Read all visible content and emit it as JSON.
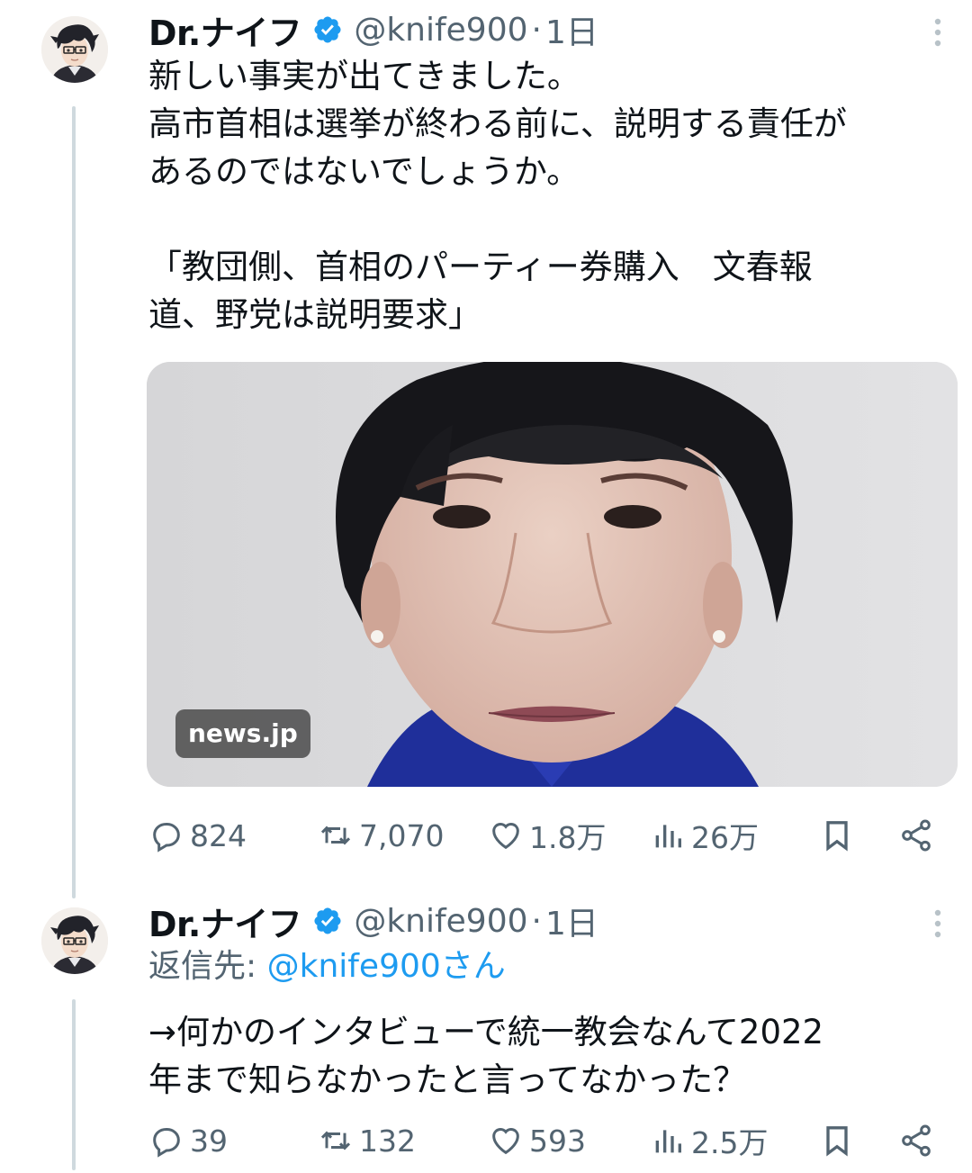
{
  "tweets": [
    {
      "author": {
        "name": "Dr.ナイフ",
        "handle": "@knife900"
      },
      "separator": "·",
      "time": "1日",
      "text": "新しい事実が出てきました。\n高市首相は選挙が終わる前に、説明する責任が\nあるのではないでしょうか。\n\n「教団側、首相のパーティー券購入　文春報\n道、野党は説明要求」",
      "media": {
        "source_badge": "news.jp"
      },
      "stats": {
        "replies": "824",
        "retweets": "7,070",
        "likes": "1.8万",
        "views": "26万"
      }
    },
    {
      "author": {
        "name": "Dr.ナイフ",
        "handle": "@knife900"
      },
      "separator": "·",
      "time": "1日",
      "reply_to": {
        "label": "返信先:",
        "mention": "@knife900さん"
      },
      "text": "→何かのインタビューで統一教会なんて2022\n年まで知らなかったと言ってなかった？",
      "stats": {
        "replies": "39",
        "retweets": "132",
        "likes": "593",
        "views": "2.5万"
      }
    }
  ],
  "colors": {
    "text_primary": "#0f1419",
    "text_secondary": "#536471",
    "link": "#1d9bf0",
    "verified": "#1d9bf0",
    "thread_line": "#cfd9de"
  },
  "icons": {
    "verified": "verified-badge-icon",
    "more": "more-vertical-icon",
    "reply": "reply-icon",
    "retweet": "retweet-icon",
    "like": "heart-icon",
    "views": "views-icon",
    "bookmark": "bookmark-icon",
    "share": "share-icon"
  }
}
